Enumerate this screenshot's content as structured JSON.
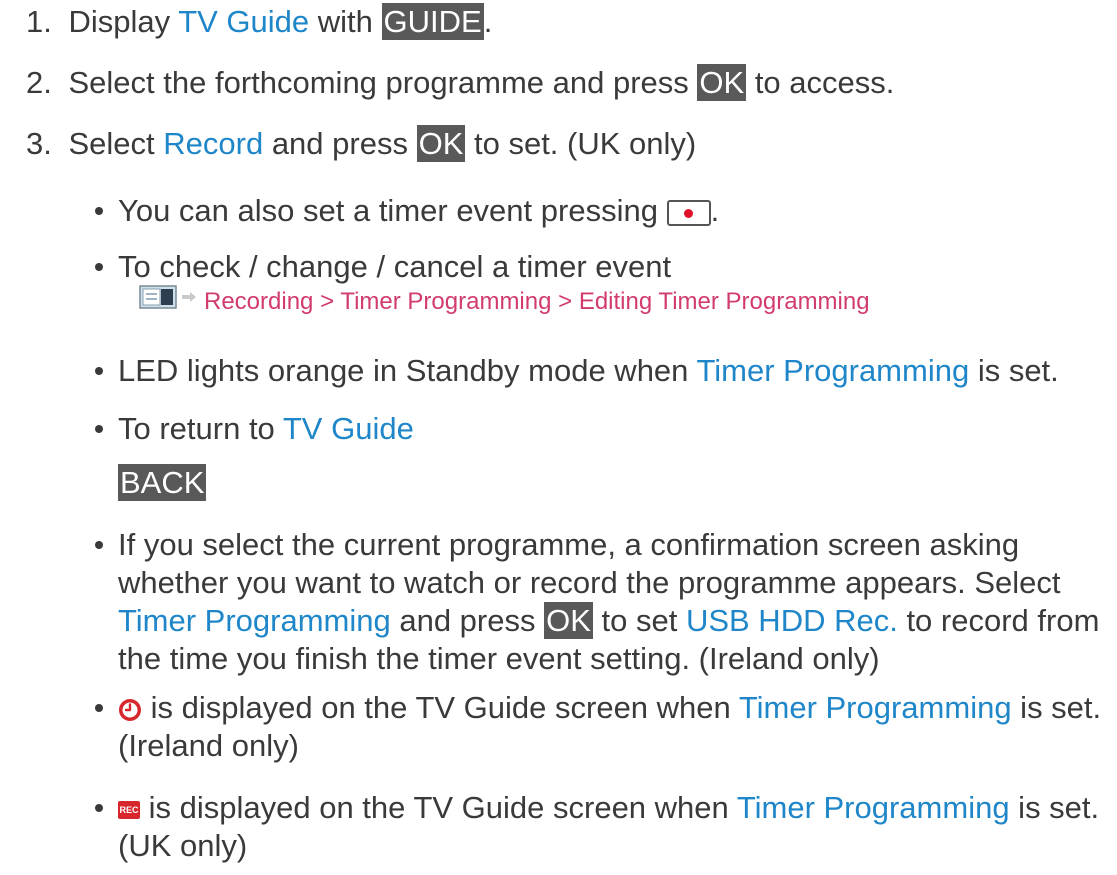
{
  "steps": [
    {
      "num": "1.",
      "pre": "Display ",
      "link": "TV Guide",
      "mid": " with ",
      "key": "GUIDE",
      "post": "."
    },
    {
      "num": "2.",
      "pre": "Select the forthcoming programme and press ",
      "key": "OK",
      "post": " to access."
    },
    {
      "num": "3.",
      "pre": "Select ",
      "link": "Record",
      "mid": " and press ",
      "key": "OK",
      "post": " to set. (UK only)"
    }
  ],
  "notes": {
    "timer_button": {
      "pre": "You can also set a timer event pressing ",
      "icon": "record-button-icon",
      "post": "."
    },
    "check_change": {
      "text": "To check / change / cancel a timer event"
    },
    "menu_path": {
      "icon": "menu-icon",
      "arrow": "arrow-icon",
      "text": "Recording > Timer Programming > Editing Timer Programming"
    },
    "led": {
      "pre": "LED lights orange in Standby mode when ",
      "link": "Timer Programming",
      "post": " is set."
    },
    "return": {
      "pre": "To return to ",
      "link": "TV Guide"
    },
    "back_key": "BACK",
    "current": {
      "pre": "If you select the current programme, a confirmation screen asking whether you want to watch or record the programme appears. Select ",
      "link1": "Timer Programming",
      "mid1": " and press ",
      "key": "OK",
      "mid2": " to set ",
      "link2": "USB HDD Rec.",
      "post": " to record from the time you finish the timer event setting. (Ireland only)"
    },
    "clock_note": {
      "icon": "clock-icon",
      "pre": " is displayed on the TV Guide screen when ",
      "link": "Timer Programming",
      "post": " is set. (Ireland only)"
    },
    "rec_note": {
      "icon": "rec-badge-icon",
      "badge": "REC",
      "pre": " is displayed on the TV Guide screen when ",
      "link": "Timer Programming",
      "post": " is set. (UK only)"
    }
  },
  "colors": {
    "link": "#1f87c9",
    "key_bg": "#595959",
    "menu_path": "#d23c6c",
    "text": "#3a3a3a"
  }
}
